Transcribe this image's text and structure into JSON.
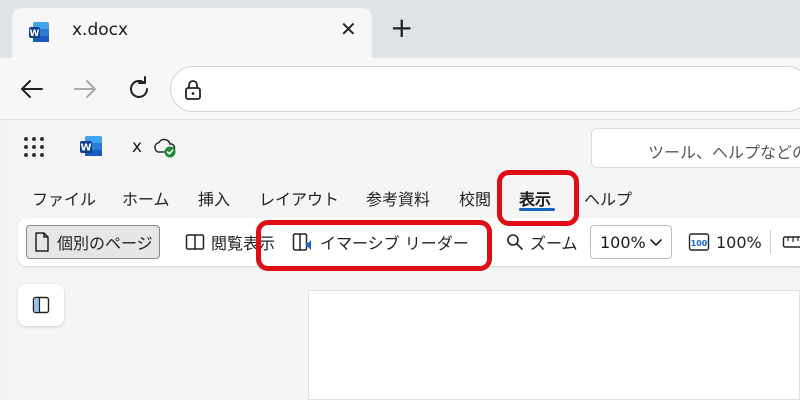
{
  "browser": {
    "tab_title": "x.docx",
    "tab_close": "✕",
    "new_tab": "+",
    "nav": {
      "back_glyph": "←",
      "forward_glyph": "→",
      "refresh_glyph": "↻"
    }
  },
  "word": {
    "doc_name": "x",
    "search_placeholder": "ツール、ヘルプなどの",
    "ribbon_tabs": [
      "ファイル",
      "ホーム",
      "挿入",
      "レイアウト",
      "参考資料",
      "校閲",
      "表示",
      "ヘルプ"
    ],
    "active_tab": "表示",
    "toolbar": {
      "page_view": "個別のページ",
      "reading_view": "閲覧表示",
      "immersive_reader": "イマーシブ リーダー",
      "zoom": "ズーム",
      "zoom_value": "100%",
      "zoom_100": "100%"
    }
  },
  "colors": {
    "highlight": "#e00d16",
    "accent": "#1668c4",
    "word_blue": "#185abd"
  },
  "icons": [
    "word-favicon-icon",
    "close-icon",
    "plus-icon",
    "back-icon",
    "forward-icon",
    "refresh-icon",
    "lock-icon",
    "app-launcher-icon",
    "word-logo-icon",
    "cloud-synced-icon",
    "page-icon",
    "book-icon",
    "immersive-reader-icon",
    "magnifier-icon",
    "chevron-down-icon",
    "zoom-100-icon",
    "ruler-icon",
    "navigation-pane-icon"
  ]
}
